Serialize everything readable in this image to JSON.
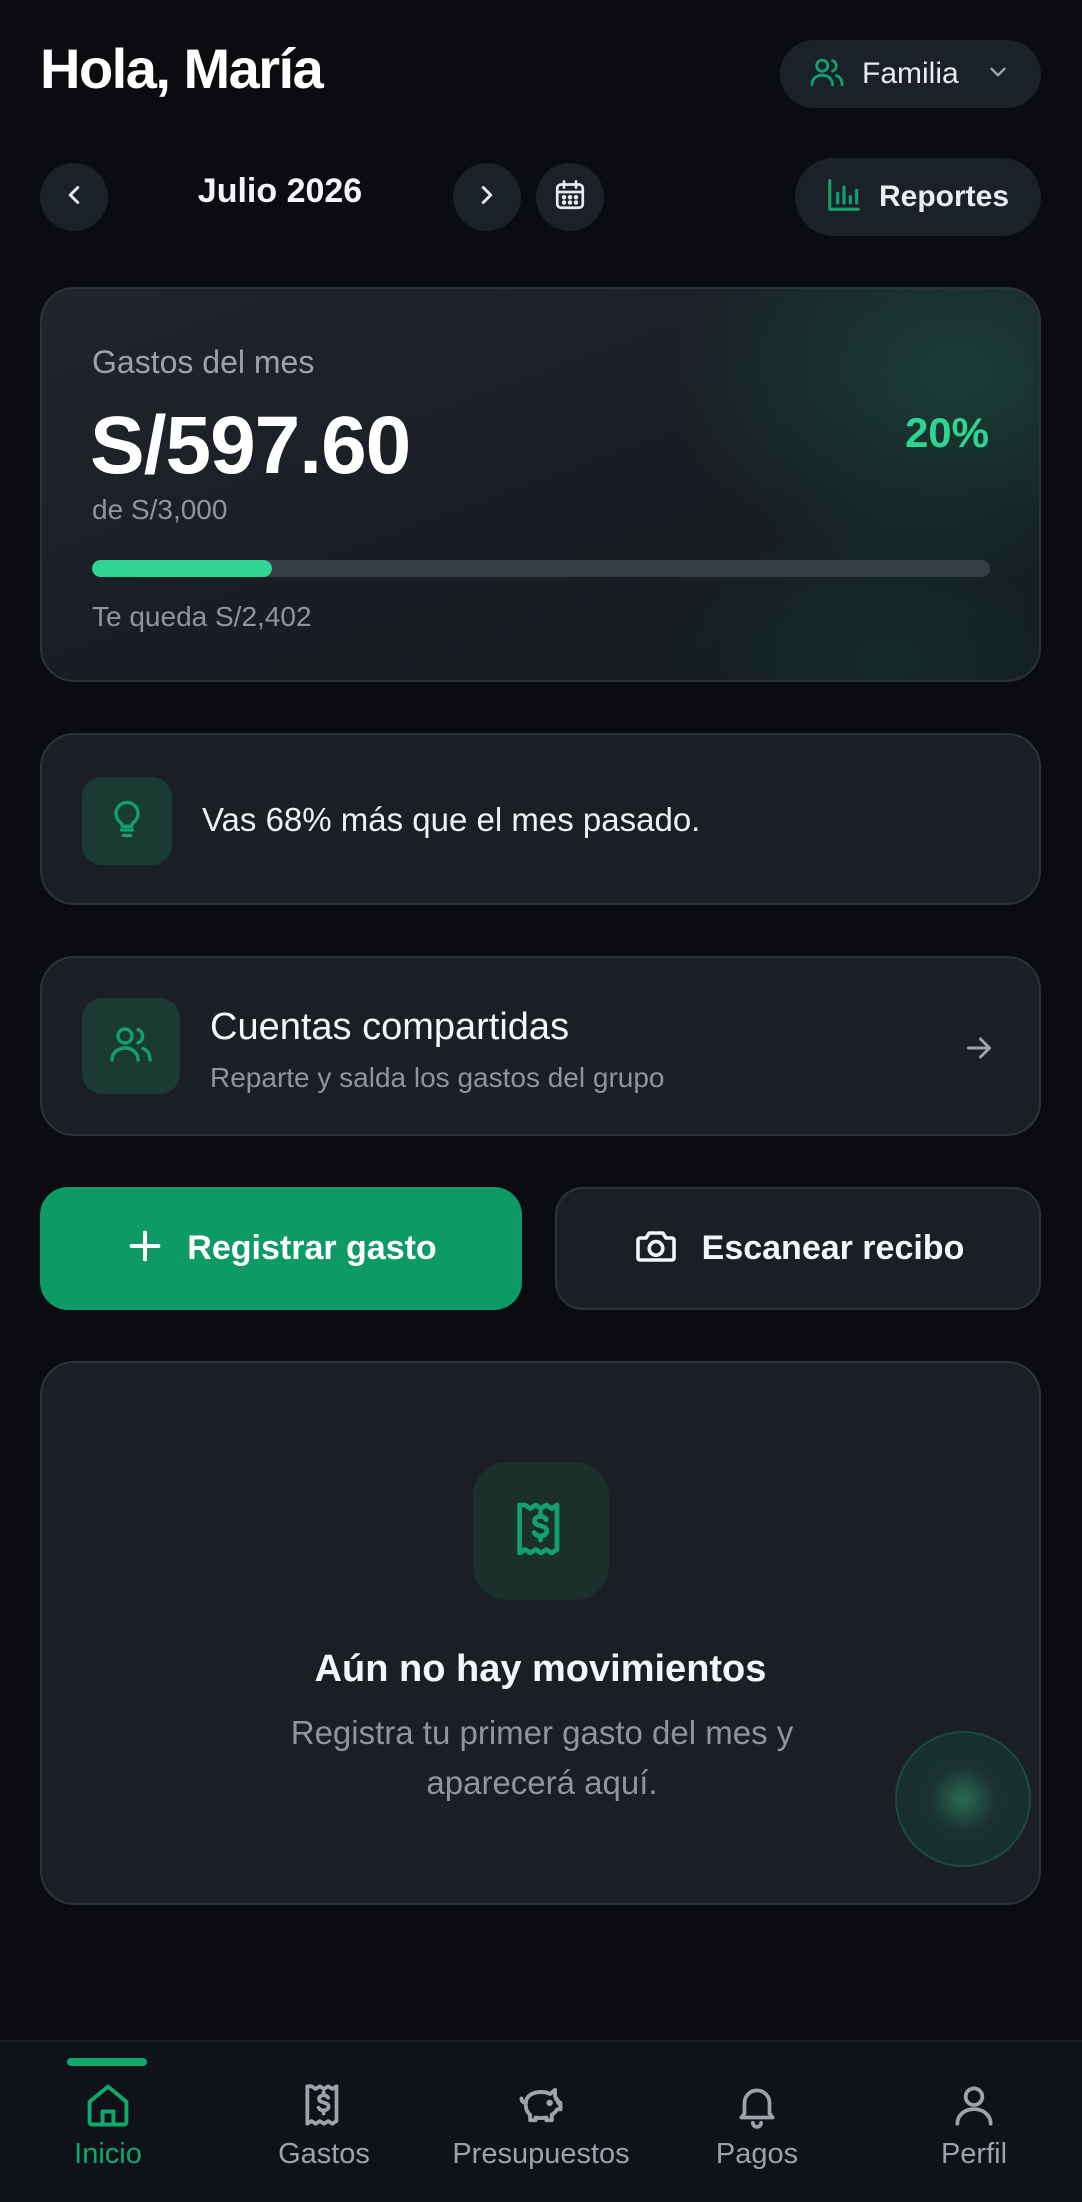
{
  "header": {
    "greeting": "Hola, María",
    "group_selector": "Familia"
  },
  "month_nav": {
    "month_label": "Julio 2026",
    "reports_label": "Reportes"
  },
  "summary": {
    "caption": "Gastos del mes",
    "amount": "S/597.60",
    "percent": "20%",
    "budget": "de S/3,000",
    "remaining": "Te queda S/2,402",
    "progress_fraction": 0.2
  },
  "insight": {
    "text": "Vas 68% más que el mes pasado.",
    "icon": "lightbulb-icon"
  },
  "shared_accounts": {
    "title": "Cuentas compartidas",
    "subtitle": "Reparte y salda los gastos del grupo"
  },
  "actions": {
    "register_label": "Registrar gasto",
    "scan_label": "Escanear recibo"
  },
  "empty_state": {
    "title": "Aún no hay movimientos",
    "description": "Registra tu primer gasto del mes y aparecerá aquí."
  },
  "bottom_nav": {
    "items": [
      {
        "label": "Inicio",
        "icon": "home-icon",
        "active": true
      },
      {
        "label": "Gastos",
        "icon": "receipt-icon",
        "active": false
      },
      {
        "label": "Presupuestos",
        "icon": "piggy-bank-icon",
        "active": false
      },
      {
        "label": "Pagos",
        "icon": "bell-icon",
        "active": false
      },
      {
        "label": "Perfil",
        "icon": "user-icon",
        "active": false
      }
    ]
  },
  "colors": {
    "accent": "#10a86d",
    "accent_bright": "#2fd493",
    "background": "#0a0c0f",
    "card": "#1a1e25"
  }
}
